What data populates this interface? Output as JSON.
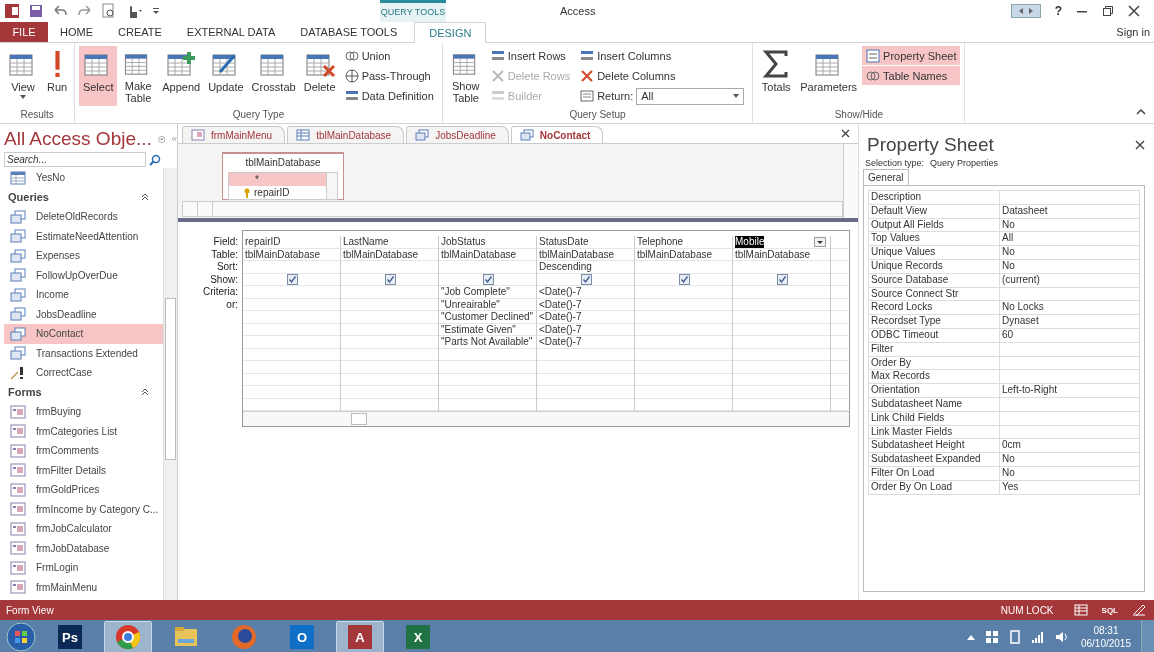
{
  "window": {
    "title": "Access",
    "context_label": "QUERY TOOLS",
    "help": "?",
    "sign_in": "Sign in"
  },
  "ribbon_tabs": [
    {
      "label": "FILE",
      "kind": "file",
      "selected": false
    },
    {
      "label": "HOME",
      "kind": "tab",
      "selected": false
    },
    {
      "label": "CREATE",
      "kind": "tab",
      "selected": false
    },
    {
      "label": "EXTERNAL DATA",
      "kind": "tab",
      "selected": false
    },
    {
      "label": "DATABASE TOOLS",
      "kind": "tab",
      "selected": false
    },
    {
      "label": "DESIGN",
      "kind": "context",
      "selected": true
    }
  ],
  "ribbon_groups": [
    {
      "label": "Results",
      "items": [
        {
          "label": "View",
          "kind": "large",
          "selected": false,
          "disabled": false,
          "menu": true
        },
        {
          "label": "Run",
          "kind": "large",
          "selected": false,
          "disabled": false,
          "menu": false
        }
      ]
    },
    {
      "label": "Query Type",
      "items": [
        {
          "label": "Select",
          "kind": "large",
          "selected": true,
          "disabled": false,
          "menu": false
        },
        {
          "label": "Make Table",
          "kind": "large",
          "selected": false,
          "disabled": false,
          "menu": false
        },
        {
          "label": "Append",
          "kind": "large",
          "selected": false,
          "disabled": false,
          "menu": false
        },
        {
          "label": "Update",
          "kind": "large",
          "selected": false,
          "disabled": false,
          "menu": false
        },
        {
          "label": "Crosstab",
          "kind": "large",
          "selected": false,
          "disabled": false,
          "menu": false
        },
        {
          "label": "Delete",
          "kind": "large",
          "selected": false,
          "disabled": false,
          "menu": false
        },
        {
          "label": "Union",
          "kind": "small",
          "selected": false,
          "disabled": false,
          "menu": false
        },
        {
          "label": "Pass-Through",
          "kind": "small",
          "selected": false,
          "disabled": false,
          "menu": false
        },
        {
          "label": "Data Definition",
          "kind": "small",
          "selected": false,
          "disabled": false,
          "menu": false
        }
      ]
    },
    {
      "label": "Query Setup",
      "items": [
        {
          "label": "Show Table",
          "kind": "large",
          "selected": false,
          "disabled": false,
          "menu": false
        },
        {
          "label": "Insert Rows",
          "kind": "small",
          "selected": false,
          "disabled": false,
          "menu": false
        },
        {
          "label": "Delete Rows",
          "kind": "small",
          "selected": false,
          "disabled": true,
          "menu": false
        },
        {
          "label": "Builder",
          "kind": "small",
          "selected": false,
          "disabled": true,
          "menu": false
        },
        {
          "label": "Insert Columns",
          "kind": "small",
          "selected": false,
          "disabled": false,
          "menu": false
        },
        {
          "label": "Delete Columns",
          "kind": "small",
          "selected": false,
          "disabled": false,
          "menu": false
        },
        {
          "label": "Return:",
          "kind": "dropdown",
          "value": "All",
          "selected": false,
          "disabled": false,
          "menu": true
        }
      ]
    },
    {
      "label": "Show/Hide",
      "items": [
        {
          "label": "Totals",
          "kind": "large",
          "selected": false,
          "disabled": false,
          "menu": false
        },
        {
          "label": "Parameters",
          "kind": "large",
          "selected": false,
          "disabled": false,
          "menu": false
        },
        {
          "label": "Property Sheet",
          "kind": "small",
          "selected": true,
          "disabled": false,
          "menu": false
        },
        {
          "label": "Table Names",
          "kind": "small",
          "selected": true,
          "disabled": false,
          "menu": false
        }
      ]
    }
  ],
  "nav": {
    "title": "All Access Obje...",
    "search_placeholder": "Search...",
    "top_items": [
      {
        "label": "YesNo",
        "kind": "table",
        "selected": false
      }
    ],
    "groups": [
      {
        "label": "Queries",
        "expanded": true,
        "items": [
          {
            "label": "DeleteOldRecords",
            "kind": "query",
            "selected": false
          },
          {
            "label": "EstimateNeedAttention",
            "kind": "query",
            "selected": false
          },
          {
            "label": "Expenses",
            "kind": "query",
            "selected": false
          },
          {
            "label": "FollowUpOverDue",
            "kind": "query",
            "selected": false
          },
          {
            "label": "Income",
            "kind": "query",
            "selected": false
          },
          {
            "label": "JobsDeadline",
            "kind": "query",
            "selected": false
          },
          {
            "label": "NoContact",
            "kind": "query",
            "selected": true
          },
          {
            "label": "Transactions Extended",
            "kind": "query",
            "selected": false
          },
          {
            "label": "CorrectCase",
            "kind": "macro",
            "selected": false
          }
        ]
      },
      {
        "label": "Forms",
        "expanded": true,
        "items": [
          {
            "label": "frmBuying",
            "kind": "form",
            "selected": false
          },
          {
            "label": "frmCategories List",
            "kind": "form",
            "selected": false
          },
          {
            "label": "frmComments",
            "kind": "form",
            "selected": false
          },
          {
            "label": "frmFilter Details",
            "kind": "form",
            "selected": false
          },
          {
            "label": "frmGoldPrices",
            "kind": "form",
            "selected": false
          },
          {
            "label": "frmIncome by Category C...",
            "kind": "form",
            "selected": false
          },
          {
            "label": "frmJobCalculator",
            "kind": "form",
            "selected": false
          },
          {
            "label": "frmJobDatabase",
            "kind": "form",
            "selected": false
          },
          {
            "label": "FrmLogin",
            "kind": "form",
            "selected": false
          },
          {
            "label": "frmMainMenu",
            "kind": "form",
            "selected": false
          }
        ]
      }
    ]
  },
  "document_tabs": [
    {
      "label": "frmMainMenu",
      "kind": "form",
      "selected": false
    },
    {
      "label": "tblMainDatabase",
      "kind": "table",
      "selected": false
    },
    {
      "label": "JobsDeadline",
      "kind": "query",
      "selected": false
    },
    {
      "label": "NoContact",
      "kind": "query",
      "selected": true
    }
  ],
  "table_box": {
    "title": "tblMainDatabase",
    "fields": [
      {
        "label": "*",
        "selected": true,
        "primary_key": false
      },
      {
        "label": "repairID",
        "selected": false,
        "primary_key": true
      }
    ]
  },
  "query_grid": {
    "row_labels": [
      "Field:",
      "Table:",
      "Sort:",
      "Show:",
      "Criteria:",
      "or:"
    ],
    "columns": [
      {
        "field": "repairID",
        "table": "tblMainDatabase",
        "show": true,
        "selected": false
      },
      {
        "field": "LastName",
        "table": "tblMainDatabase",
        "show": true,
        "selected": false
      },
      {
        "field": "JobStatus",
        "table": "tblMainDatabase",
        "show": true,
        "selected": false,
        "criteria": [
          "\"Job Complete\"",
          "\"Unreairable\"",
          "\"Customer Declined\"",
          "\"Estimate Given\"",
          "\"Parts Not Available\""
        ]
      },
      {
        "field": "StatusDate",
        "table": "tblMainDatabase",
        "sort": "Descending",
        "show": true,
        "selected": false,
        "criteria": [
          "<Date()-7",
          "<Date()-7",
          "<Date()-7",
          "<Date()-7",
          "<Date()-7"
        ]
      },
      {
        "field": "Telephone",
        "table": "tblMainDatabase",
        "show": true,
        "selected": false
      },
      {
        "field": "Mobile",
        "table": "tblMainDatabase",
        "show": true,
        "selected": true
      }
    ]
  },
  "property_sheet": {
    "title": "Property Sheet",
    "selection_label": "Selection type:",
    "selection_value": "Query Properties",
    "tabs": [
      {
        "label": "General",
        "selected": true
      }
    ],
    "rows": [
      {
        "name": "Description"
      },
      {
        "name": "Default View",
        "value": "Datasheet"
      },
      {
        "name": "Output All Fields",
        "value": "No"
      },
      {
        "name": "Top Values",
        "value": "All"
      },
      {
        "name": "Unique Values",
        "value": "No"
      },
      {
        "name": "Unique Records",
        "value": "No"
      },
      {
        "name": "Source Database",
        "value": "(current)"
      },
      {
        "name": "Source Connect Str"
      },
      {
        "name": "Record Locks",
        "value": "No Locks"
      },
      {
        "name": "Recordset Type",
        "value": "Dynaset"
      },
      {
        "name": "ODBC Timeout",
        "value": "60"
      },
      {
        "name": "Filter"
      },
      {
        "name": "Order By"
      },
      {
        "name": "Max Records"
      },
      {
        "name": "Orientation",
        "value": "Left-to-Right"
      },
      {
        "name": "Subdatasheet Name"
      },
      {
        "name": "Link Child Fields"
      },
      {
        "name": "Link Master Fields"
      },
      {
        "name": "Subdatasheet Height",
        "value": "0cm"
      },
      {
        "name": "Subdatasheet Expanded",
        "value": "No"
      },
      {
        "name": "Filter On Load",
        "value": "No"
      },
      {
        "name": "Order By On Load",
        "value": "Yes"
      }
    ]
  },
  "status_bar": {
    "text": "Form View",
    "num_lock": "NUM LOCK",
    "sql": "SQL"
  },
  "taskbar": {
    "apps": [
      {
        "kind": "photoshop",
        "glyph": "Ps",
        "active": false
      },
      {
        "kind": "chrome",
        "active": true
      },
      {
        "kind": "folder",
        "active": false
      },
      {
        "kind": "firefox",
        "active": false
      },
      {
        "kind": "outlook",
        "glyph": "O",
        "active": false
      },
      {
        "kind": "access",
        "glyph": "A",
        "active": true
      },
      {
        "kind": "excel",
        "glyph": "X",
        "active": false
      }
    ],
    "time": "08:31",
    "date": "06/10/2015"
  }
}
